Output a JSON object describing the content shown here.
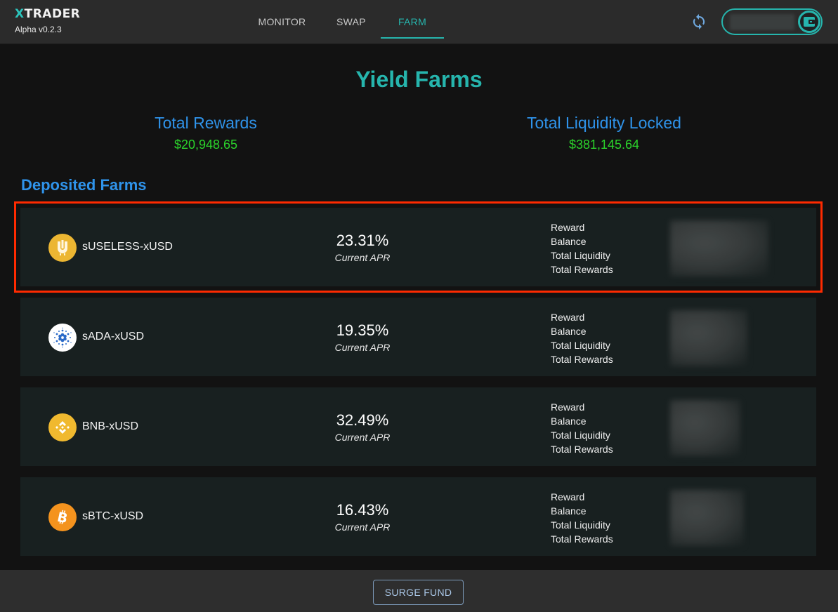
{
  "app": {
    "logo_prefix": "X",
    "logo_suffix": "TRADER",
    "version": "Alpha v0.2.3"
  },
  "nav": {
    "tabs": [
      {
        "label": "MONITOR",
        "active": false
      },
      {
        "label": "SWAP",
        "active": false
      },
      {
        "label": "FARM",
        "active": true
      }
    ],
    "refresh_icon": "refresh-icon",
    "wallet_icon": "wallet-icon",
    "wallet_address": "(blurred)"
  },
  "page": {
    "title": "Yield Farms",
    "stats": [
      {
        "label": "Total Rewards",
        "value": "$20,948.65"
      },
      {
        "label": "Total Liquidity Locked",
        "value": "$381,145.64"
      }
    ],
    "section_title": "Deposited Farms"
  },
  "farms": [
    {
      "pair": "sUSELESS-xUSD",
      "icon": "useless-coin-icon",
      "apr": "23.31%",
      "apr_label": "Current APR",
      "labels": [
        "Reward",
        "Balance",
        "Total Liquidity",
        "Total Rewards"
      ],
      "values_hidden": true,
      "highlighted": true
    },
    {
      "pair": "sADA-xUSD",
      "icon": "cardano-coin-icon",
      "apr": "19.35%",
      "apr_label": "Current APR",
      "labels": [
        "Reward",
        "Balance",
        "Total Liquidity",
        "Total Rewards"
      ],
      "values_hidden": true,
      "highlighted": false
    },
    {
      "pair": "BNB-xUSD",
      "icon": "bnb-coin-icon",
      "apr": "32.49%",
      "apr_label": "Current APR",
      "labels": [
        "Reward",
        "Balance",
        "Total Liquidity",
        "Total Rewards"
      ],
      "values_hidden": true,
      "highlighted": false
    },
    {
      "pair": "sBTC-xUSD",
      "icon": "bitcoin-coin-icon",
      "apr": "16.43%",
      "apr_label": "Current APR",
      "labels": [
        "Reward",
        "Balance",
        "Total Liquidity",
        "Total Rewards"
      ],
      "values_hidden": true,
      "highlighted": false
    }
  ],
  "footer": {
    "button_label": "SURGE FUND"
  },
  "colors": {
    "accent_teal": "#26b5ad",
    "stat_label_blue": "#2f93ea",
    "stat_value_green": "#2bd22b",
    "highlight_red": "#ff2a00"
  }
}
